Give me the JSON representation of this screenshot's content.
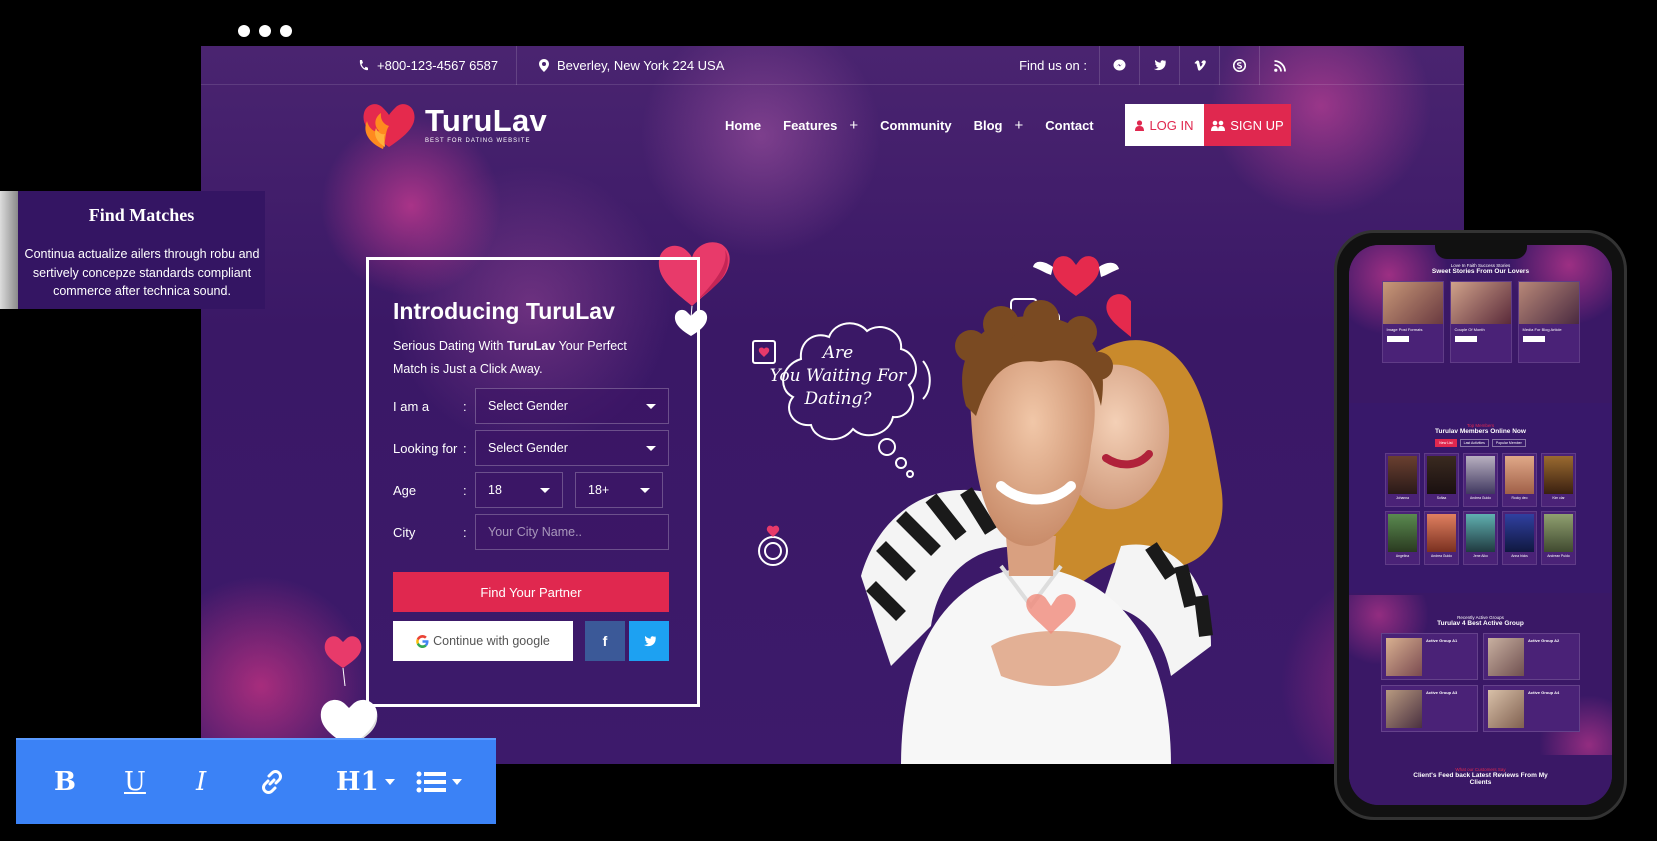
{
  "topbar": {
    "phone": "+800-123-4567 6587",
    "address": "Beverley, New York 224 USA",
    "find_us": "Find us on :",
    "social_icons": [
      "messenger-icon",
      "twitter-icon",
      "vimeo-icon",
      "skype-icon",
      "rss-icon"
    ]
  },
  "brand": {
    "name": "TuruLav",
    "tagline": "BEST FOR  DATING WEBSITE"
  },
  "nav": {
    "items": [
      {
        "label": "Home",
        "has_sub": false
      },
      {
        "label": "Features",
        "has_sub": true
      },
      {
        "label": "Community",
        "has_sub": false
      },
      {
        "label": "Blog",
        "has_sub": true
      },
      {
        "label": "Contact",
        "has_sub": false
      }
    ],
    "login": "LOG IN",
    "signup": "SIGN UP",
    "plus": "+"
  },
  "form": {
    "title": "Introducing TuruLav",
    "sub_pre": "Serious Dating With ",
    "sub_bold": "TuruLav",
    "sub_post": " Your Perfect Match is Just a Click Away.",
    "colon": ":",
    "i_am_label": "I am a",
    "i_am_value": "Select Gender",
    "looking_label": "Looking for",
    "looking_value": "Select Gender",
    "age_label": "Age",
    "age_from": "18",
    "age_to": "18+",
    "city_label": "City",
    "city_placeholder": "Your City Name..",
    "find_button": "Find Your Partner",
    "google_button": "Continue with google",
    "fb_label": "f"
  },
  "hero": {
    "thought_line1": "Are",
    "thought_line2": "You Waiting For",
    "thought_line3": "Dating?"
  },
  "find_matches": {
    "title": "Find Matches",
    "text": "Continua actualize ailers through robu and sertively concepze standards compliant commerce after technica sound."
  },
  "toolbar": {
    "bold": "B",
    "underline": "U",
    "italic": "I",
    "heading": "H1"
  },
  "phone": {
    "stories_kicker": "Love In Faith Success Stories",
    "stories_title": "Sweet Stories From Our Lovers",
    "stories": [
      {
        "title": "Image Post Formats"
      },
      {
        "title": "Couple Of Month"
      },
      {
        "title": "Media For Blog Article"
      }
    ],
    "members_kicker": "Top Members",
    "members_title": "Turulav Members Online Now",
    "member_tabs": [
      "New List",
      "Last Activities",
      "Popular Member"
    ],
    "members": [
      {
        "name": "Johanna",
        "status": "Active 1 day"
      },
      {
        "name": "Sofiaa",
        "status": "Active 1 day"
      },
      {
        "name": "Andrea Guido",
        "status": "Active 1 day"
      },
      {
        "name": "Rocky deo",
        "status": "Active 1 day"
      },
      {
        "name": "Kim clar",
        "status": "Active 1 day"
      },
      {
        "name": "Angelina",
        "status": "Active 1 day"
      },
      {
        "name": "Andrea Guido",
        "status": "Active 1 day"
      },
      {
        "name": "Jene Aiko",
        "status": "Active 1 day"
      },
      {
        "name": "Anna hicks",
        "status": "Active 1 day"
      },
      {
        "name": "Andrean Puido",
        "status": "Active 1 day"
      }
    ],
    "groups_kicker": "Recently Active Groups",
    "groups_title": "Turulav 4 Best Active Group",
    "groups": [
      {
        "title": "Active Group A1"
      },
      {
        "title": "Active Group A2"
      },
      {
        "title": "Active Group A3"
      },
      {
        "title": "Active Group A4"
      }
    ],
    "feedback_kicker": "What our Customers Say",
    "feedback_title": "Client's Feed back Latest Reviews From My Clients"
  },
  "colors": {
    "accent": "#e0284f",
    "bg": "#3a1866",
    "toolbar": "#3b82f6"
  }
}
